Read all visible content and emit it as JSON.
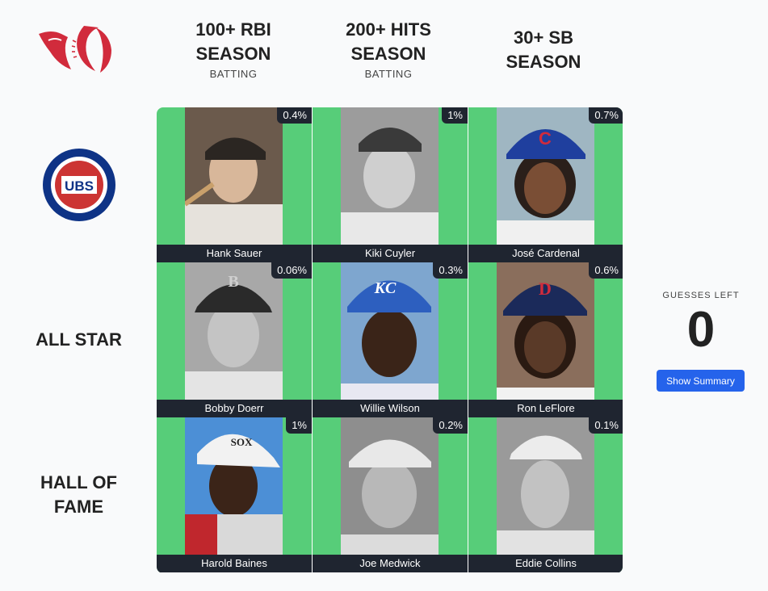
{
  "columns": [
    {
      "title_line1": "100+ RBI",
      "title_line2": "SEASON",
      "sub": "BATTING"
    },
    {
      "title_line1": "200+ HITS",
      "title_line2": "SEASON",
      "sub": "BATTING"
    },
    {
      "title_line1": "30+ SB",
      "title_line2": "SEASON",
      "sub": ""
    }
  ],
  "rows": [
    {
      "type": "team-logo",
      "team_icon": "cubs-logo-icon"
    },
    {
      "title_line1": "ALL STAR",
      "title_line2": ""
    },
    {
      "title_line1": "HALL OF",
      "title_line2": "FAME"
    }
  ],
  "cells": [
    [
      {
        "player": "Hank Sauer",
        "pct": "0.4%"
      },
      {
        "player": "Kiki Cuyler",
        "pct": "1%"
      },
      {
        "player": "José Cardenal",
        "pct": "0.7%"
      }
    ],
    [
      {
        "player": "Bobby Doerr",
        "pct": "0.06%"
      },
      {
        "player": "Willie Wilson",
        "pct": "0.3%"
      },
      {
        "player": "Ron LeFlore",
        "pct": "0.6%"
      }
    ],
    [
      {
        "player": "Harold Baines",
        "pct": "1%"
      },
      {
        "player": "Joe Medwick",
        "pct": "0.2%"
      },
      {
        "player": "Eddie Collins",
        "pct": "0.1%"
      }
    ]
  ],
  "guesses": {
    "label": "GUESSES LEFT",
    "count": "0"
  },
  "summary_button": {
    "label": "Show Summary"
  },
  "colors": {
    "correct_cell": "#57cd79",
    "label_bg": "#1f2530",
    "button": "#2563eb",
    "cubs_blue": "#0e3386",
    "cubs_red": "#cc3433"
  }
}
